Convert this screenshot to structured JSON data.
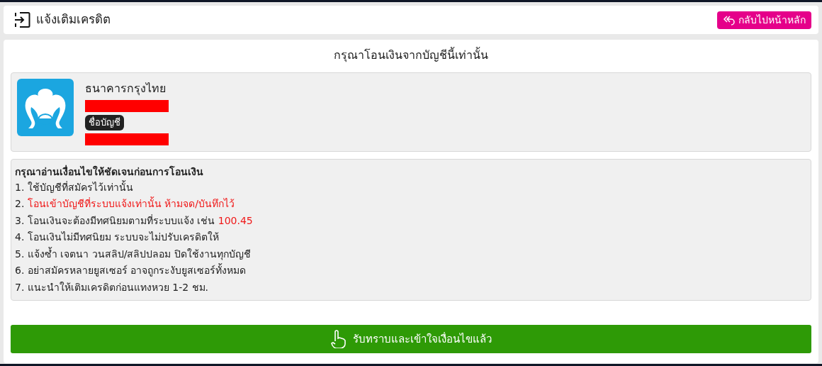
{
  "header": {
    "title": "แจ้งเติมเครดิต",
    "back_button": "กลับไปหน้าหลัก"
  },
  "instruction": "กรุณาโอนเงินจากบัญชีนี้เท่านั้น",
  "bank": {
    "name": "ธนาคารกรุงไทย",
    "account_number_redacted": true,
    "account_name_label": "ชื่อบัญชี",
    "account_name_redacted": true
  },
  "conditions": {
    "title": "กรุณาอ่านเงื่อนไขให้ชัดเจนก่อนการโอนเงิน",
    "rules": [
      {
        "parts": [
          {
            "text": "1. ใช้บัญชีที่สมัครไว้เท่านั้น",
            "highlight": false
          }
        ]
      },
      {
        "parts": [
          {
            "text": "2. ",
            "highlight": false
          },
          {
            "text": "โอนเข้าบัญชีที่ระบบแจ้งเท่านั้น ห้ามจด/บันทึกไว้",
            "highlight": true
          }
        ]
      },
      {
        "parts": [
          {
            "text": "3. โอนเงินจะต้องมีทศนิยมตามที่ระบบแจ้ง เช่น ",
            "highlight": false
          },
          {
            "text": "100.45",
            "highlight": true
          }
        ]
      },
      {
        "parts": [
          {
            "text": "4. โอนเงินไม่มีทศนิยม ระบบจะไม่ปรับเครดิตให้",
            "highlight": false
          }
        ]
      },
      {
        "parts": [
          {
            "text": "5. แจ้งซ้ำ เจตนา วนสลิป/สลิปปลอม ปิดใช้งานทุกบัญชี",
            "highlight": false
          }
        ]
      },
      {
        "parts": [
          {
            "text": "6. อย่าสมัครหลายยูสเซอร์ อาจถูกระงับยูสเซอร์ทั้งหมด",
            "highlight": false
          }
        ]
      },
      {
        "parts": [
          {
            "text": "7. แนะนำให้เติมเครดิตก่อนแทงหวย 1-2 ชม.",
            "highlight": false
          }
        ]
      }
    ]
  },
  "accept_button": "รับทราบและเข้าใจเงื่อนไขแล้ว"
}
